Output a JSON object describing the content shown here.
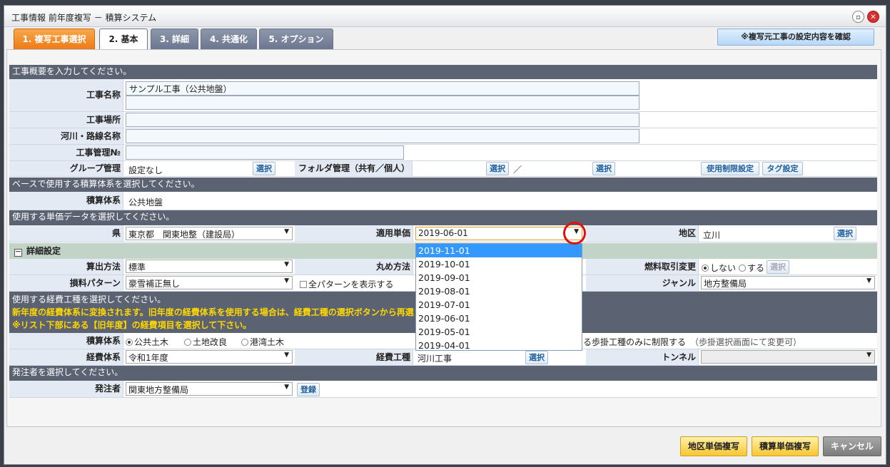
{
  "window": {
    "title": "工事情報 前年度複写 － 積算システム",
    "restore_icon": "restore-icon",
    "close_icon": "close-icon"
  },
  "tabs": [
    "1. 複写工事選択",
    "2. 基本",
    "3. 詳細",
    "4. 共通化",
    "5. オプション"
  ],
  "confirm_button": "※複写元工事の設定内容を確認",
  "section1": {
    "header": "工事概要を入力してください。"
  },
  "fields": {
    "name_label": "工事名称",
    "name_value": "サンプル工事（公共地盤）",
    "place_label": "工事場所",
    "river_label": "河川・路線名称",
    "mgmt_label": "工事管理№",
    "group_label": "グループ管理",
    "group_value": "設定なし",
    "select": "選択",
    "folder_label": "フォルダ管理（共有／個人）",
    "folder_sep": "／",
    "limit_button": "使用制限設定",
    "tag_button": "タグ設定"
  },
  "section2": {
    "header": "ベースで使用する積算体系を選択してください。",
    "label": "積算体系",
    "value": "公共地盤"
  },
  "section3": {
    "header": "使用する単価データを選択してください。",
    "pref_label": "県",
    "pref_value": "東京都　関東地整（建設局）",
    "price_label": "適用単価",
    "price_value": "2019-06-01",
    "area_label": "地区",
    "area_value": "立川"
  },
  "detail": {
    "header": "詳細設定",
    "collapse": "－",
    "calc_label": "算出方法",
    "calc_value": "標準",
    "round_label": "丸め方法",
    "fuel_label": "燃料取引変更",
    "fuel_off": "しない",
    "fuel_on": "する",
    "loss_label": "損料パターン",
    "loss_value": "豪雪補正無し",
    "all_pattern": "全パターンを表示する",
    "genre_label": "ジャンル",
    "genre_value": "地方整備局"
  },
  "section4": {
    "header": "使用する経費工種を選択してください。",
    "note1": "新年度の経費体系に変換されます。旧年度の経費体系を使用する場合は、経費工種の選択ボタンから再選",
    "note2": "※リスト下部にある【旧年度】の経費項目を選択して下さい。",
    "system_label": "積算体系",
    "radio1": "公共土木",
    "radio2": "土地改良",
    "radio3": "港湾土木",
    "restrict_text": "る歩掛工種のみに制限する",
    "restrict_note": "（歩掛選択画面にて変更可）",
    "cost_label": "経費体系",
    "cost_value": "令和1年度",
    "kind_label": "経費工種",
    "kind_value": "河川工事",
    "tunnel_label": "トンネル"
  },
  "section5": {
    "header": "発注者を選択してください。",
    "label": "発注者",
    "value": "関東地方整備局",
    "register": "登録"
  },
  "dropdown": {
    "options": [
      "2019-11-01",
      "2019-10-01",
      "2019-09-01",
      "2019-08-01",
      "2019-07-01",
      "2019-06-01",
      "2019-05-01",
      "2019-04-01"
    ],
    "highlighted": "2019-11-01"
  },
  "footer": {
    "area_copy": "地区単価複写",
    "calc_copy": "積算単価複写",
    "cancel": "キャンセル"
  },
  "colors": {
    "orange_tab": "#ee7a18",
    "section": "#5b6272",
    "highlight": "#3399ff",
    "marker": "#e01010"
  }
}
